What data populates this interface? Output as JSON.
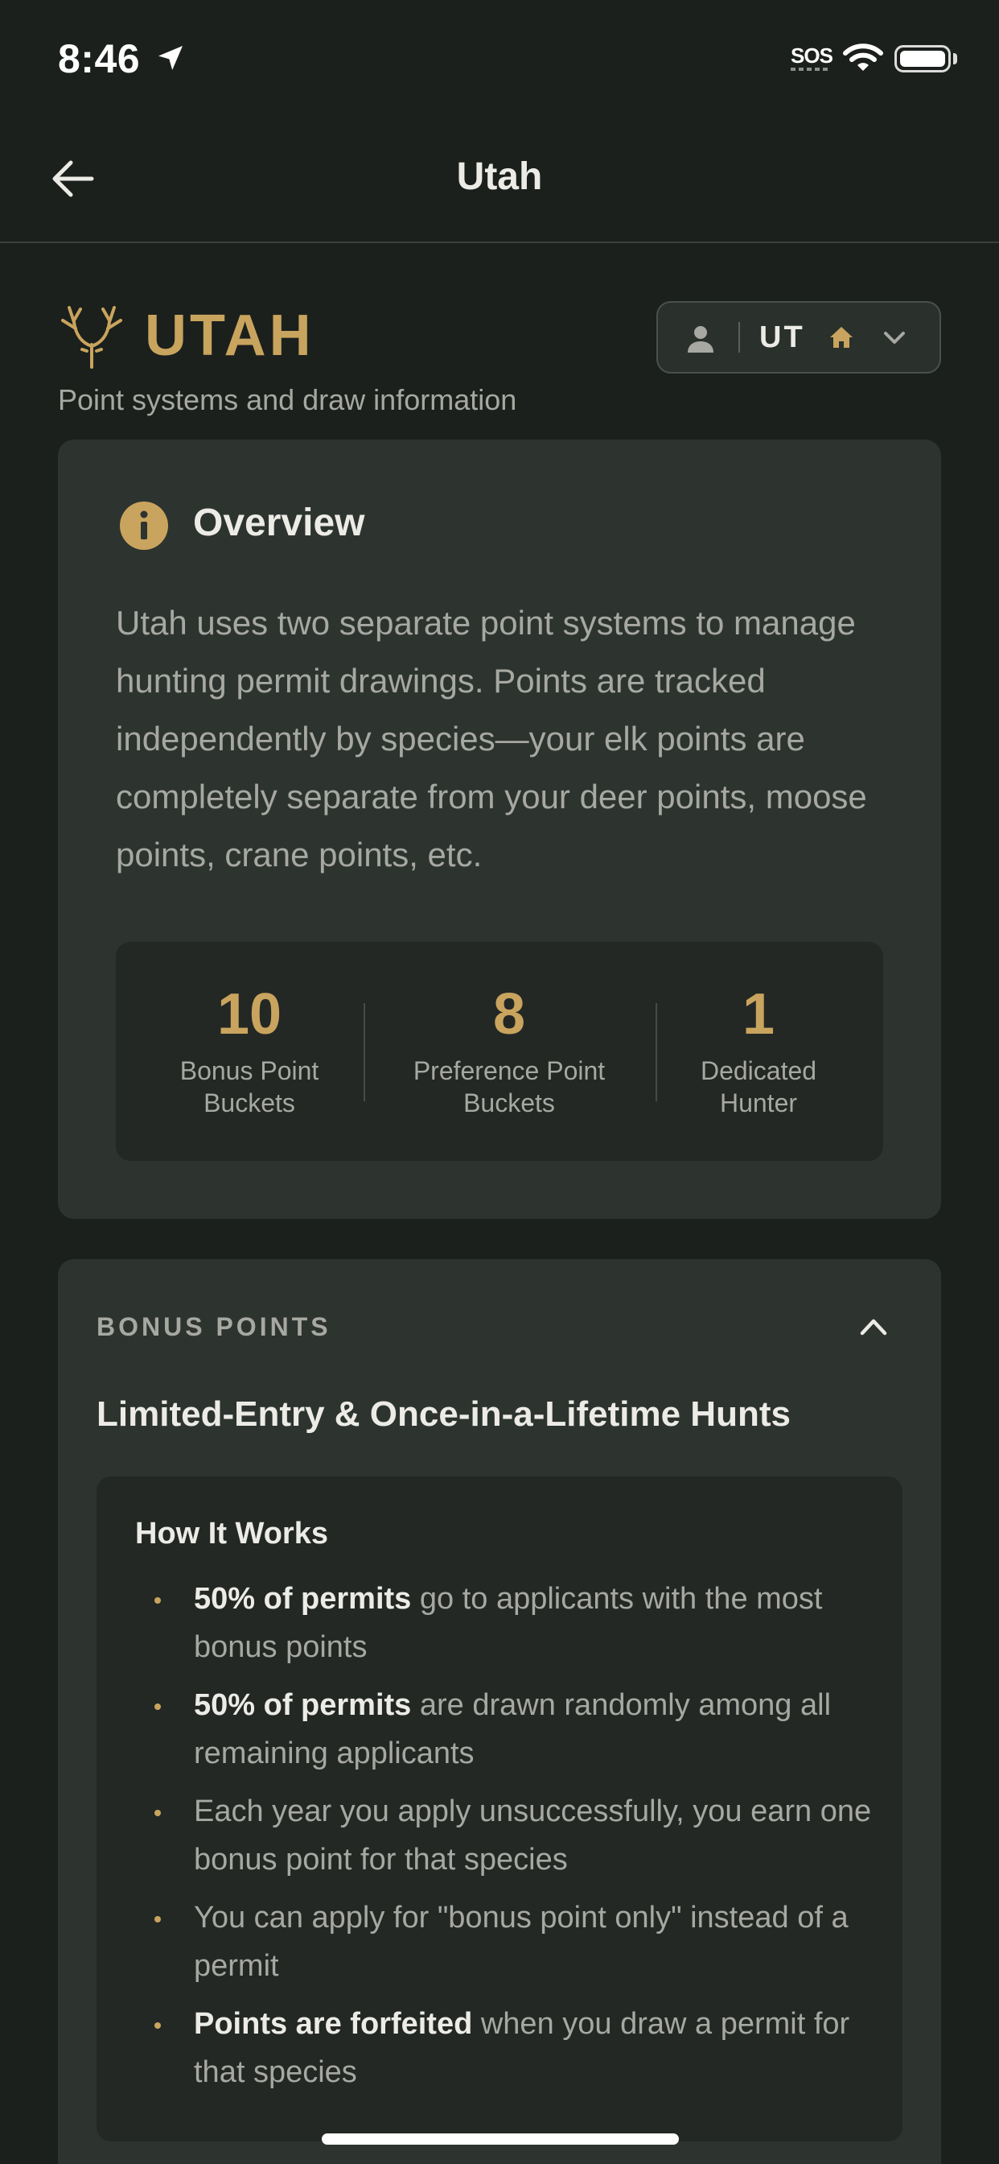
{
  "status_bar": {
    "time": "8:46",
    "sos": "SOS"
  },
  "header": {
    "title": "Utah"
  },
  "state": {
    "name": "UTAH",
    "subtitle": "Point systems and draw information",
    "selector_code": "UT"
  },
  "overview": {
    "title": "Overview",
    "body": "Utah uses two separate point systems to manage hunting permit drawings. Points are tracked independently by species—your elk points are completely separate from your deer points, moose points, crane points, etc.",
    "stats": [
      {
        "value": "10",
        "label_line1": "Bonus Point",
        "label_line2": "Buckets"
      },
      {
        "value": "8",
        "label_line1": "Preference Point",
        "label_line2": "Buckets"
      },
      {
        "value": "1",
        "label_line1": "Dedicated",
        "label_line2": "Hunter"
      }
    ]
  },
  "bonus_points": {
    "section_label": "BONUS POINTS",
    "title": "Limited-Entry & Once-in-a-Lifetime Hunts",
    "how_title": "How It Works",
    "bullets": [
      {
        "bold": "50% of permits",
        "text": " go to applicants with the most bonus points"
      },
      {
        "bold": "50% of permits",
        "text": " are drawn randomly among all remaining applicants"
      },
      {
        "bold": "",
        "text": "Each year you apply unsuccessfully, you earn one bonus point for that species"
      },
      {
        "bold": "",
        "text": "You can apply for \"bonus point only\" instead of a permit"
      },
      {
        "bold": "Points are forfeited",
        "text": " when you draw a permit for that species"
      }
    ]
  },
  "colors": {
    "background": "#1b201c",
    "card": "#2d3430",
    "inner_card": "#232825",
    "accent_gold": "#c9a45e",
    "text_primary": "#ecebe6",
    "text_secondary": "#a7a8a2"
  },
  "icons": [
    "location-arrow-icon",
    "wifi-icon",
    "battery-icon",
    "back-arrow-icon",
    "antler-icon",
    "person-icon",
    "home-icon",
    "chevron-down-icon",
    "info-icon",
    "chevron-up-icon"
  ]
}
